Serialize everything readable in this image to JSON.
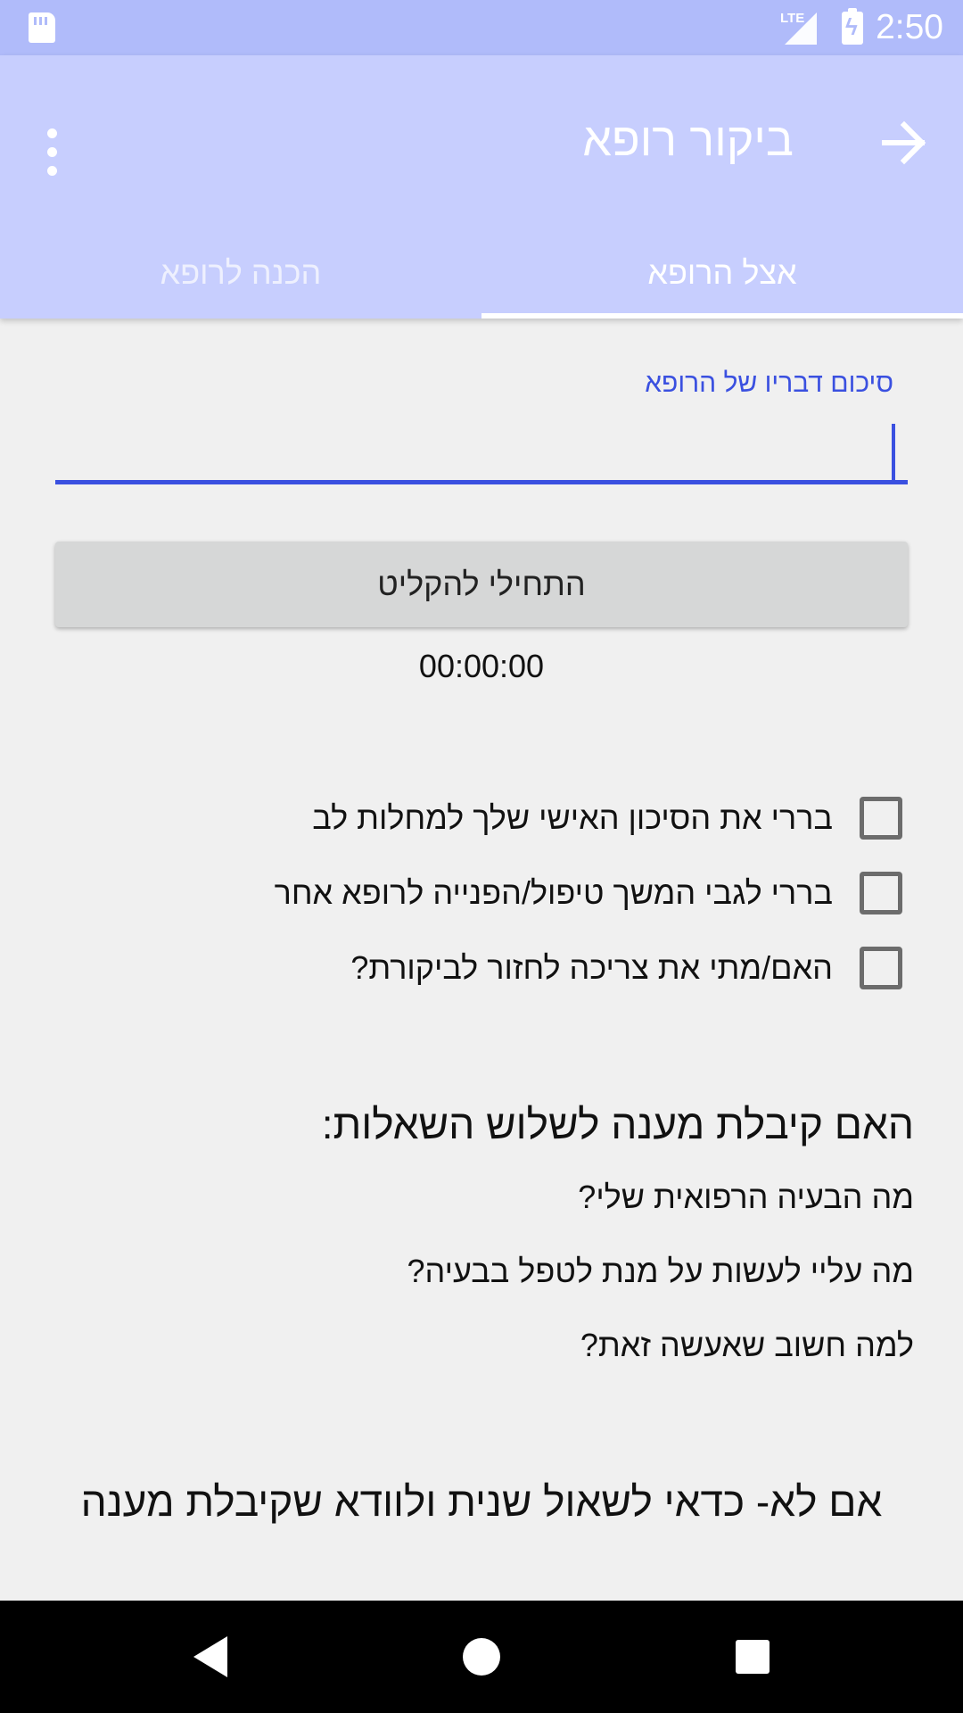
{
  "status_bar": {
    "network_label": "LTE",
    "time": "2:50",
    "icons": [
      "sd-card-icon",
      "signal-icon",
      "battery-charging-icon"
    ]
  },
  "app_bar": {
    "title": "ביקור רופא",
    "back_icon": "arrow-forward-icon",
    "menu_icon": "more-vert-icon",
    "colors": {
      "status_bar": "#b0bbfa",
      "app_bar": "#c7cefe",
      "accent": "#3a50e0"
    }
  },
  "tabs": [
    {
      "label": "הכנה לרופא",
      "selected": false
    },
    {
      "label": "אצל הרופא",
      "selected": true
    }
  ],
  "summary_field": {
    "label": "סיכום דבריו של הרופא",
    "value": ""
  },
  "record": {
    "button_label": "התחילי להקליט",
    "timer": "00:00:00"
  },
  "checklist": [
    {
      "label": "בררי את הסיכון האישי שלך למחלות לב",
      "checked": false
    },
    {
      "label": "בררי לגבי המשך טיפול/הפנייה לרופא אחר",
      "checked": false
    },
    {
      "label": "האם/מתי את צריכה לחזור לביקורת?",
      "checked": false
    }
  ],
  "questions": {
    "title": "האם קיבלת מענה לשלוש השאלות:",
    "items": [
      "מה הבעיה הרפואית שלי?",
      "מה עליי לעשות על מנת לטפל בבעיה?",
      "למה חשוב שאעשה זאת?"
    ],
    "closing": "אם לא- כדאי לשאול שנית ולוודא שקיבלת מענה"
  },
  "nav_bar": {
    "icons": [
      "nav-back-icon",
      "nav-home-icon",
      "nav-recents-icon"
    ]
  }
}
